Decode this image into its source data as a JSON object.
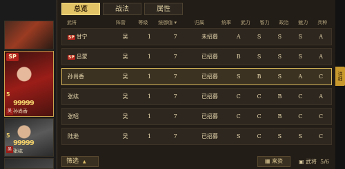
{
  "tabs": [
    "总览",
    "战法",
    "属性"
  ],
  "columns": [
    "武将",
    "阵营",
    "等级",
    "统御值",
    "归属",
    "统率",
    "武力",
    "智力",
    "政治",
    "魅力",
    "兵种"
  ],
  "rows": [
    {
      "sp": "SP",
      "name": "甘宁",
      "camp": "吴",
      "level": "1",
      "cmd": "7",
      "status": "未招募",
      "a": "A",
      "b": "S",
      "c": "S",
      "d": "S",
      "e": "A",
      "selected": false
    },
    {
      "sp": "SP",
      "name": "吕蒙",
      "camp": "吴",
      "level": "1",
      "cmd": "7",
      "status": "已招募",
      "a": "B",
      "b": "S",
      "c": "S",
      "d": "S",
      "e": "A",
      "selected": false
    },
    {
      "sp": "",
      "name": "孙尚香",
      "camp": "吴",
      "level": "1",
      "cmd": "7",
      "status": "已招募",
      "a": "S",
      "b": "B",
      "c": "S",
      "d": "A",
      "e": "C",
      "selected": true
    },
    {
      "sp": "",
      "name": "张纮",
      "camp": "吴",
      "level": "1",
      "cmd": "7",
      "status": "已招募",
      "a": "C",
      "b": "C",
      "c": "B",
      "d": "C",
      "e": "A",
      "selected": false
    },
    {
      "sp": "",
      "name": "张昭",
      "camp": "吴",
      "level": "1",
      "cmd": "7",
      "status": "已招募",
      "a": "C",
      "b": "C",
      "c": "B",
      "d": "C",
      "e": "C",
      "selected": false
    },
    {
      "sp": "",
      "name": "陆逊",
      "camp": "吴",
      "level": "1",
      "cmd": "7",
      "status": "已招募",
      "a": "S",
      "b": "C",
      "c": "S",
      "d": "S",
      "e": "C",
      "selected": false
    }
  ],
  "cards": [
    {
      "name": "",
      "stars": ""
    },
    {
      "name": "孙尚香",
      "stars": "99999",
      "num": "5",
      "badge": "SP",
      "clan": "吴"
    },
    {
      "name": "张纮",
      "stars": "99999",
      "num": "5",
      "clan": "吴"
    }
  ],
  "footer": {
    "filter": "筛选",
    "resource": "来资",
    "count_label": "武将",
    "count": "5/6"
  },
  "sidetab": "详细"
}
